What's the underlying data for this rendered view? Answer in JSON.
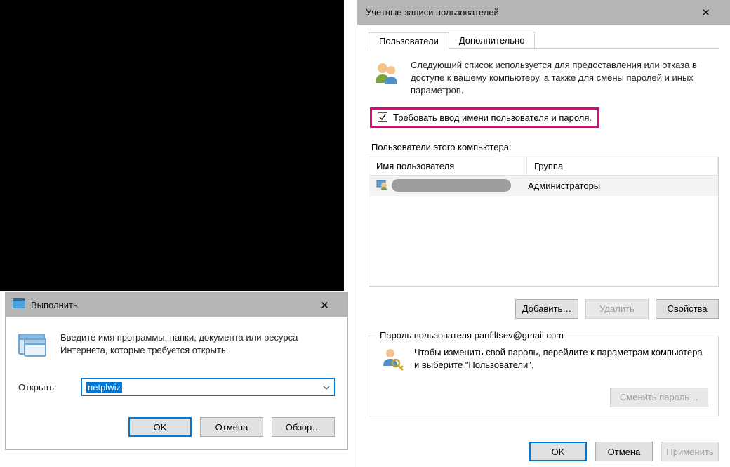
{
  "run": {
    "title": "Выполнить",
    "desc": "Введите имя программы, папки, документа или ресурса Интернета, которые требуется открыть.",
    "open_label": "Открыть:",
    "input_value": "netplwiz",
    "ok": "OK",
    "cancel": "Отмена",
    "browse": "Обзор…"
  },
  "uac": {
    "title": "Учетные записи пользователей",
    "tabs": {
      "users": "Пользователи",
      "advanced": "Дополнительно"
    },
    "desc": "Следующий список используется для предоставления или отказа в доступе к вашему компьютеру, а также для смены паролей и иных параметров.",
    "checkbox_label": "Требовать ввод имени пользователя и пароля.",
    "list_label": "Пользователи этого компьютера:",
    "columns": {
      "name": "Имя пользователя",
      "group": "Группа"
    },
    "rows": [
      {
        "group": "Администраторы"
      }
    ],
    "buttons": {
      "add": "Добавить…",
      "remove": "Удалить",
      "props": "Свойства"
    },
    "password_section": {
      "legend": "Пароль пользователя panfiltsev@gmail.com",
      "text": "Чтобы изменить свой пароль, перейдите к параметрам компьютера и выберите \"Пользователи\".",
      "change": "Сменить пароль…"
    },
    "footer": {
      "ok": "OK",
      "cancel": "Отмена",
      "apply": "Применить"
    }
  }
}
